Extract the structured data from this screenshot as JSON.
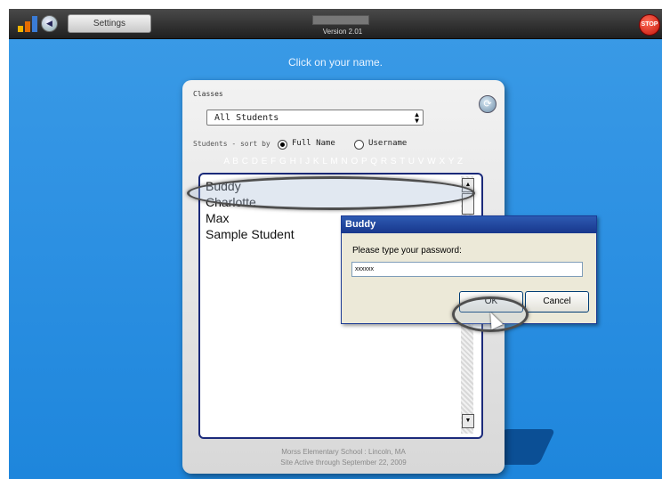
{
  "header": {
    "settings_label": "Settings",
    "version": "Version 2.01",
    "stop_label": "STOP",
    "logo_colors": [
      "#f0b400",
      "#e56c00",
      "#3a7bd5"
    ]
  },
  "instruction": "Click on your name.",
  "panel": {
    "classes_label": "Classes",
    "classes_selected": "All Students",
    "sort_label": "Students - sort by",
    "sort_options": [
      {
        "label": "Full Name",
        "selected": true
      },
      {
        "label": "Username",
        "selected": false
      }
    ],
    "alphabet": "A B C D E F G H I J K L M N O P Q R S T U V W X Y Z",
    "students": [
      "Buddy",
      "Charlotte",
      "Max",
      "Sample Student"
    ],
    "selected_student": "Buddy",
    "footer": {
      "school": "Morss Elementary School : Lincoln, MA",
      "active": "Site Active through September 22, 2009"
    }
  },
  "dialog": {
    "title": "Buddy",
    "prompt": "Please type your password:",
    "password_value": "xxxxxx",
    "ok_label": "OK",
    "cancel_label": "Cancel"
  },
  "colors": {
    "background": "#2f92e3",
    "listbox_border": "#1b2a7a",
    "dialog_title": "#18378c"
  }
}
